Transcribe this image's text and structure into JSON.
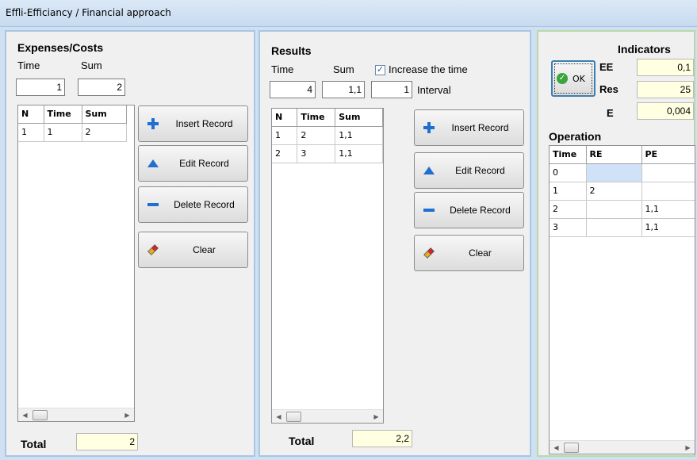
{
  "window": {
    "title": "Effli-Efficiancy / Financial approach"
  },
  "expenses": {
    "title": "Expenses/Costs",
    "time_label": "Time",
    "sum_label": "Sum",
    "time_value": "1",
    "sum_value": "2",
    "columns": [
      "N",
      "Time",
      "Sum"
    ],
    "rows": [
      [
        "1",
        "1",
        "2"
      ]
    ],
    "buttons": {
      "insert": "Insert Record",
      "edit": "Edit Record",
      "delete": "Delete Record",
      "clear": "Clear"
    },
    "total_label": "Total",
    "total_value": "2"
  },
  "results": {
    "title": "Results",
    "time_label": "Time",
    "sum_label": "Sum",
    "increase_label": "Increase the time",
    "increase_checked": true,
    "time_value": "4",
    "sum_value": "1,1",
    "interval_value": "1",
    "interval_label": "Interval",
    "columns": [
      "N",
      "Time",
      "Sum"
    ],
    "rows": [
      [
        "1",
        "2",
        "1,1"
      ],
      [
        "2",
        "3",
        "1,1"
      ]
    ],
    "buttons": {
      "insert": "Insert Record",
      "edit": "Edit Record",
      "delete": "Delete Record",
      "clear": "Clear"
    },
    "total_label": "Total",
    "total_value": "2,2"
  },
  "indicators": {
    "title": "Indicators",
    "ok_label": "OK",
    "ee_label": "EE",
    "ee_value": "0,1",
    "res_label": "Res",
    "res_value": "25",
    "e_label": "E",
    "e_value": "0,004",
    "operation_title": "Operation",
    "columns": [
      "Time",
      "RE",
      "PE"
    ],
    "rows": [
      [
        "0",
        "",
        ""
      ],
      [
        "1",
        "2",
        ""
      ],
      [
        "2",
        "",
        "1,1"
      ],
      [
        "3",
        "",
        "1,1"
      ]
    ]
  },
  "colors": {
    "accent_blue": "#1f6fd0",
    "total_bg": "#ffffe1",
    "panel_border": "#a9c6e3",
    "indicator_border": "#b7d9a8"
  }
}
